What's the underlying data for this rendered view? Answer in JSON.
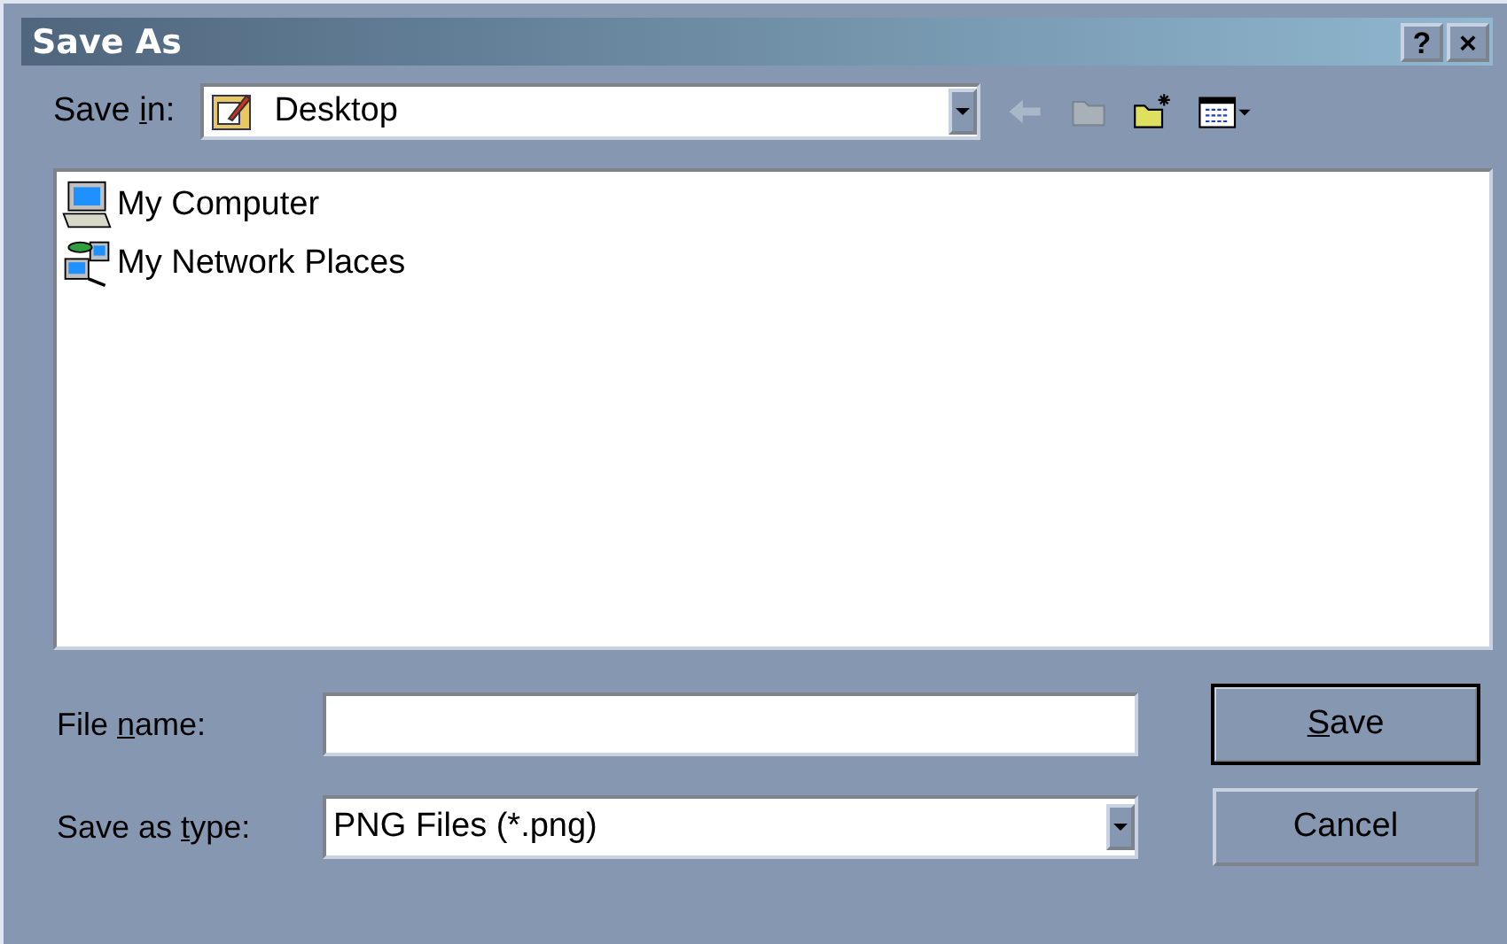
{
  "window": {
    "title": "Save As",
    "title_buttons": [
      "?",
      "×"
    ]
  },
  "save_in": {
    "label": {
      "pre": "Save ",
      "key": "i",
      "post": "n:"
    },
    "value": "Desktop"
  },
  "files": [
    {
      "name": "My Computer",
      "kind": "computer"
    },
    {
      "name": "My Network Places",
      "kind": "network"
    }
  ],
  "file_name": {
    "label": {
      "pre": "File ",
      "key": "n",
      "post": "ame:"
    }
  },
  "save_as_type": {
    "label": {
      "pre": "Save as ",
      "key": "t",
      "post": "ype:"
    },
    "value": "PNG Files (*.png)"
  },
  "buttons": [
    {
      "label": {
        "key": "S",
        "post": "ave"
      },
      "default": true
    },
    {
      "label": {
        "pre": "Cancel"
      },
      "default": false
    }
  ]
}
